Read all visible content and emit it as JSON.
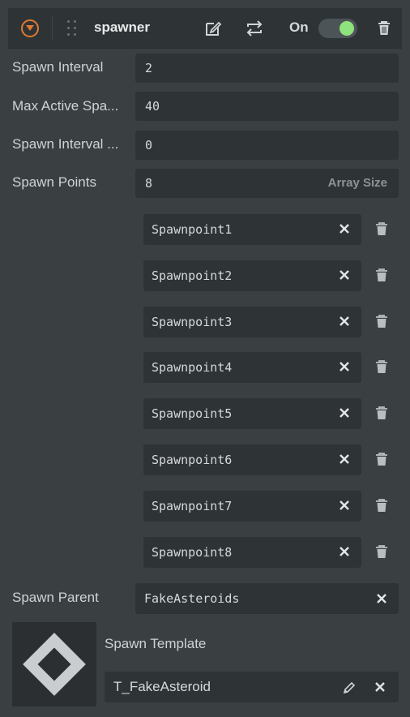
{
  "header": {
    "title": "spawner",
    "toggle_label": "On",
    "toggle_on": true,
    "icons": [
      "collapse-icon",
      "drag-grip-icon",
      "edit-icon",
      "swap-icon",
      "trash-icon"
    ]
  },
  "properties": {
    "spawn_interval": {
      "label": "Spawn Interval",
      "value": "2"
    },
    "max_active": {
      "label": "Max Active Spa...",
      "value": "40"
    },
    "spawn_interval_2": {
      "label": "Spawn Interval ...",
      "value": "0"
    },
    "spawn_points": {
      "label": "Spawn Points",
      "size": "8",
      "size_hint": "Array Size",
      "items": [
        "Spawnpoint1",
        "Spawnpoint2",
        "Spawnpoint3",
        "Spawnpoint4",
        "Spawnpoint5",
        "Spawnpoint6",
        "Spawnpoint7",
        "Spawnpoint8"
      ]
    },
    "spawn_parent": {
      "label": "Spawn Parent",
      "value": "FakeAsteroids"
    },
    "spawn_template": {
      "label": "Spawn Template",
      "value": "T_FakeAsteroid"
    }
  },
  "colors": {
    "accent": "#e07a2f",
    "toggle_knob": "#8fe37c",
    "background": "#3a3f42",
    "field": "#2e3335"
  }
}
